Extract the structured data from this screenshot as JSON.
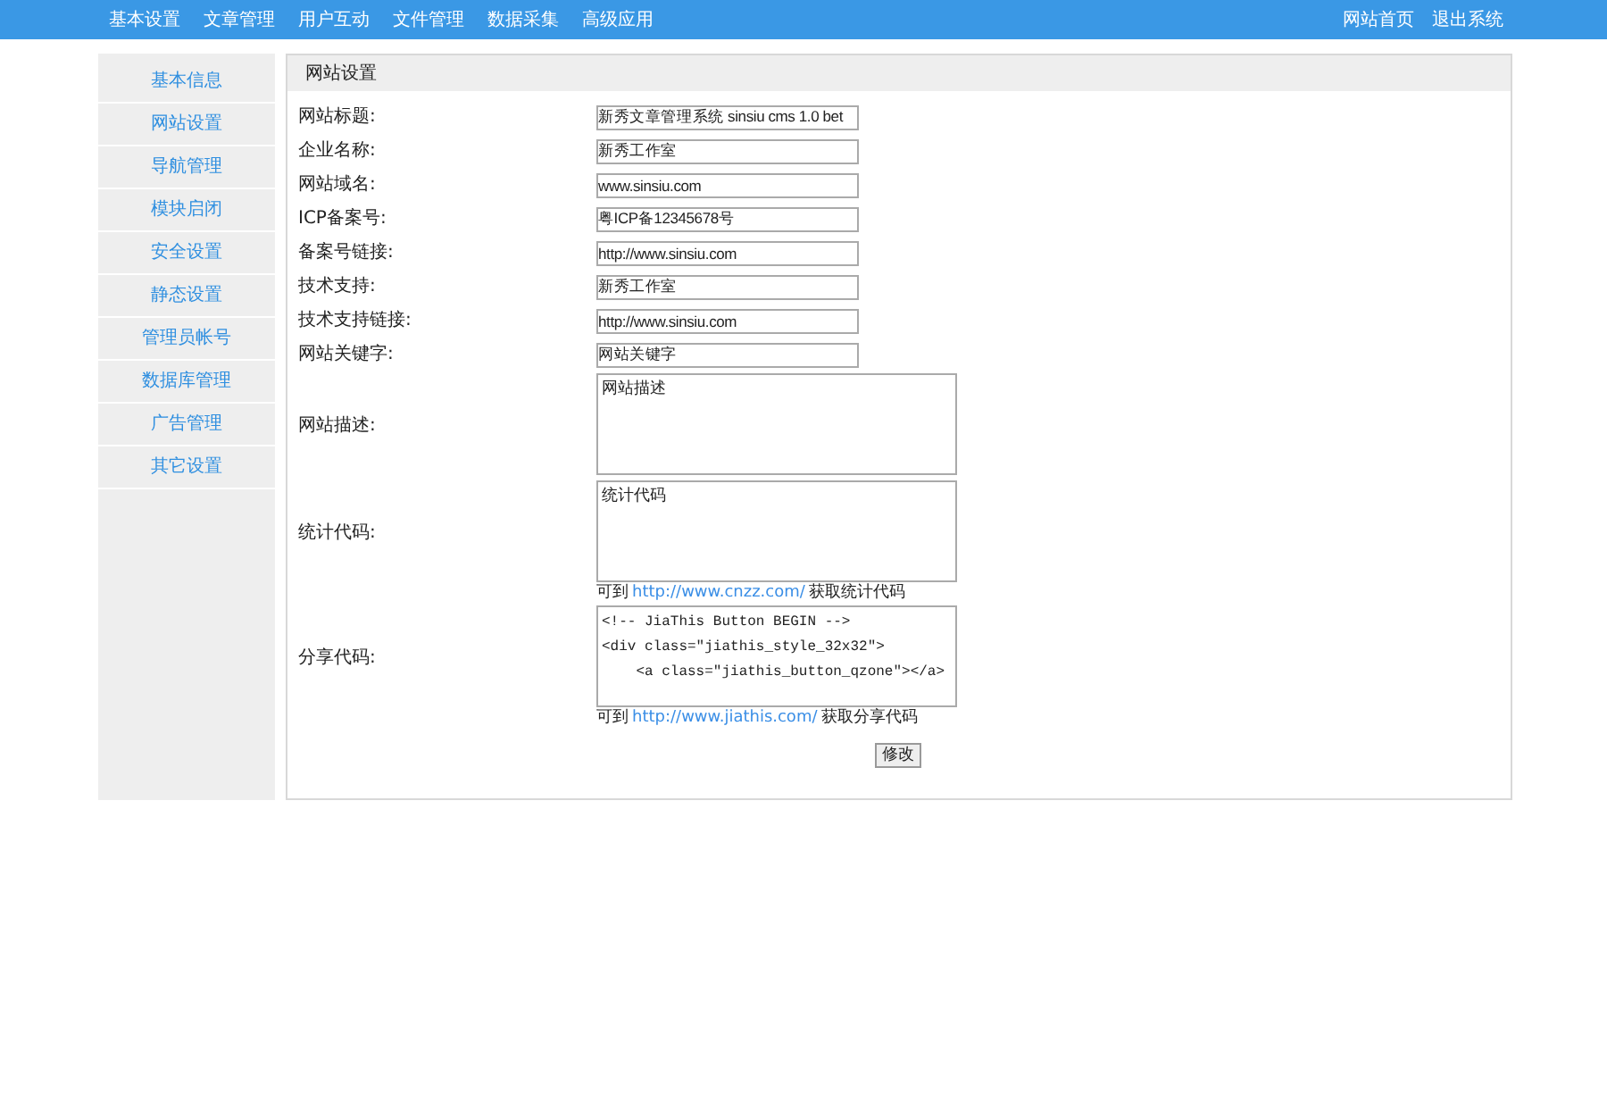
{
  "top_nav": {
    "items": [
      "基本设置",
      "文章管理",
      "用户互动",
      "文件管理",
      "数据采集",
      "高级应用"
    ],
    "right_links": [
      "网站首页",
      "退出系统"
    ]
  },
  "sidebar": {
    "items": [
      "基本信息",
      "网站设置",
      "导航管理",
      "模块启闭",
      "安全设置",
      "静态设置",
      "管理员帐号",
      "数据库管理",
      "广告管理",
      "其它设置"
    ]
  },
  "panel": {
    "title": "网站设置",
    "fields": [
      {
        "kind": "input",
        "label": "网站标题:",
        "value": "新秀文章管理系统 sinsiu cms 1.0 bet"
      },
      {
        "kind": "input",
        "label": "企业名称:",
        "value": "新秀工作室"
      },
      {
        "kind": "input",
        "label": "网站域名:",
        "value": "www.sinsiu.com"
      },
      {
        "kind": "input",
        "label": "ICP备案号:",
        "value": "粤ICP备12345678号"
      },
      {
        "kind": "input",
        "label": "备案号链接:",
        "value": "http://www.sinsiu.com"
      },
      {
        "kind": "input",
        "label": "技术支持:",
        "value": "新秀工作室"
      },
      {
        "kind": "input",
        "label": "技术支持链接:",
        "value": "http://www.sinsiu.com"
      },
      {
        "kind": "input",
        "label": "网站关键字:",
        "value": "网站关键字"
      },
      {
        "kind": "textarea",
        "label": "网站描述:",
        "value": "网站描述"
      },
      {
        "kind": "textarea",
        "label": "统计代码:",
        "value": "统计代码",
        "hint": {
          "before": "可到",
          "link": "http://www.cnzz.com/",
          "after": "获取统计代码"
        }
      },
      {
        "kind": "code",
        "label": "分享代码:",
        "value": "<!-- JiaThis Button BEGIN -->\n<div class=\"jiathis_style_32x32\">\n\t<a class=\"jiathis_button_qzone\"></a>",
        "hint": {
          "before": "可到",
          "link": "http://www.jiathis.com/",
          "after": "获取分享代码"
        }
      }
    ],
    "submit": "修改"
  }
}
